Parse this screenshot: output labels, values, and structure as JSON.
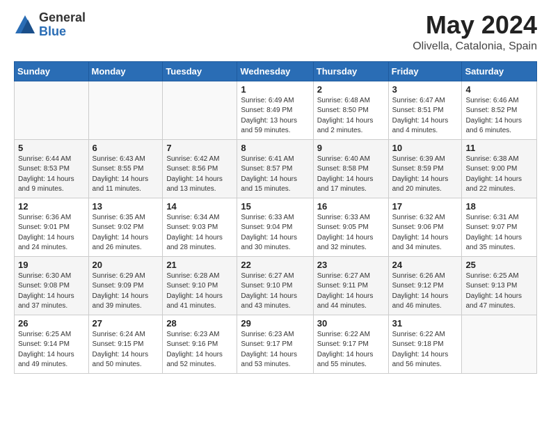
{
  "logo": {
    "general": "General",
    "blue": "Blue"
  },
  "header": {
    "month": "May 2024",
    "location": "Olivella, Catalonia, Spain"
  },
  "weekdays": [
    "Sunday",
    "Monday",
    "Tuesday",
    "Wednesday",
    "Thursday",
    "Friday",
    "Saturday"
  ],
  "weeks": [
    [
      {
        "day": "",
        "info": ""
      },
      {
        "day": "",
        "info": ""
      },
      {
        "day": "",
        "info": ""
      },
      {
        "day": "1",
        "info": "Sunrise: 6:49 AM\nSunset: 8:49 PM\nDaylight: 13 hours\nand 59 minutes."
      },
      {
        "day": "2",
        "info": "Sunrise: 6:48 AM\nSunset: 8:50 PM\nDaylight: 14 hours\nand 2 minutes."
      },
      {
        "day": "3",
        "info": "Sunrise: 6:47 AM\nSunset: 8:51 PM\nDaylight: 14 hours\nand 4 minutes."
      },
      {
        "day": "4",
        "info": "Sunrise: 6:46 AM\nSunset: 8:52 PM\nDaylight: 14 hours\nand 6 minutes."
      }
    ],
    [
      {
        "day": "5",
        "info": "Sunrise: 6:44 AM\nSunset: 8:53 PM\nDaylight: 14 hours\nand 9 minutes."
      },
      {
        "day": "6",
        "info": "Sunrise: 6:43 AM\nSunset: 8:55 PM\nDaylight: 14 hours\nand 11 minutes."
      },
      {
        "day": "7",
        "info": "Sunrise: 6:42 AM\nSunset: 8:56 PM\nDaylight: 14 hours\nand 13 minutes."
      },
      {
        "day": "8",
        "info": "Sunrise: 6:41 AM\nSunset: 8:57 PM\nDaylight: 14 hours\nand 15 minutes."
      },
      {
        "day": "9",
        "info": "Sunrise: 6:40 AM\nSunset: 8:58 PM\nDaylight: 14 hours\nand 17 minutes."
      },
      {
        "day": "10",
        "info": "Sunrise: 6:39 AM\nSunset: 8:59 PM\nDaylight: 14 hours\nand 20 minutes."
      },
      {
        "day": "11",
        "info": "Sunrise: 6:38 AM\nSunset: 9:00 PM\nDaylight: 14 hours\nand 22 minutes."
      }
    ],
    [
      {
        "day": "12",
        "info": "Sunrise: 6:36 AM\nSunset: 9:01 PM\nDaylight: 14 hours\nand 24 minutes."
      },
      {
        "day": "13",
        "info": "Sunrise: 6:35 AM\nSunset: 9:02 PM\nDaylight: 14 hours\nand 26 minutes."
      },
      {
        "day": "14",
        "info": "Sunrise: 6:34 AM\nSunset: 9:03 PM\nDaylight: 14 hours\nand 28 minutes."
      },
      {
        "day": "15",
        "info": "Sunrise: 6:33 AM\nSunset: 9:04 PM\nDaylight: 14 hours\nand 30 minutes."
      },
      {
        "day": "16",
        "info": "Sunrise: 6:33 AM\nSunset: 9:05 PM\nDaylight: 14 hours\nand 32 minutes."
      },
      {
        "day": "17",
        "info": "Sunrise: 6:32 AM\nSunset: 9:06 PM\nDaylight: 14 hours\nand 34 minutes."
      },
      {
        "day": "18",
        "info": "Sunrise: 6:31 AM\nSunset: 9:07 PM\nDaylight: 14 hours\nand 35 minutes."
      }
    ],
    [
      {
        "day": "19",
        "info": "Sunrise: 6:30 AM\nSunset: 9:08 PM\nDaylight: 14 hours\nand 37 minutes."
      },
      {
        "day": "20",
        "info": "Sunrise: 6:29 AM\nSunset: 9:09 PM\nDaylight: 14 hours\nand 39 minutes."
      },
      {
        "day": "21",
        "info": "Sunrise: 6:28 AM\nSunset: 9:10 PM\nDaylight: 14 hours\nand 41 minutes."
      },
      {
        "day": "22",
        "info": "Sunrise: 6:27 AM\nSunset: 9:10 PM\nDaylight: 14 hours\nand 43 minutes."
      },
      {
        "day": "23",
        "info": "Sunrise: 6:27 AM\nSunset: 9:11 PM\nDaylight: 14 hours\nand 44 minutes."
      },
      {
        "day": "24",
        "info": "Sunrise: 6:26 AM\nSunset: 9:12 PM\nDaylight: 14 hours\nand 46 minutes."
      },
      {
        "day": "25",
        "info": "Sunrise: 6:25 AM\nSunset: 9:13 PM\nDaylight: 14 hours\nand 47 minutes."
      }
    ],
    [
      {
        "day": "26",
        "info": "Sunrise: 6:25 AM\nSunset: 9:14 PM\nDaylight: 14 hours\nand 49 minutes."
      },
      {
        "day": "27",
        "info": "Sunrise: 6:24 AM\nSunset: 9:15 PM\nDaylight: 14 hours\nand 50 minutes."
      },
      {
        "day": "28",
        "info": "Sunrise: 6:23 AM\nSunset: 9:16 PM\nDaylight: 14 hours\nand 52 minutes."
      },
      {
        "day": "29",
        "info": "Sunrise: 6:23 AM\nSunset: 9:17 PM\nDaylight: 14 hours\nand 53 minutes."
      },
      {
        "day": "30",
        "info": "Sunrise: 6:22 AM\nSunset: 9:17 PM\nDaylight: 14 hours\nand 55 minutes."
      },
      {
        "day": "31",
        "info": "Sunrise: 6:22 AM\nSunset: 9:18 PM\nDaylight: 14 hours\nand 56 minutes."
      },
      {
        "day": "",
        "info": ""
      }
    ]
  ]
}
